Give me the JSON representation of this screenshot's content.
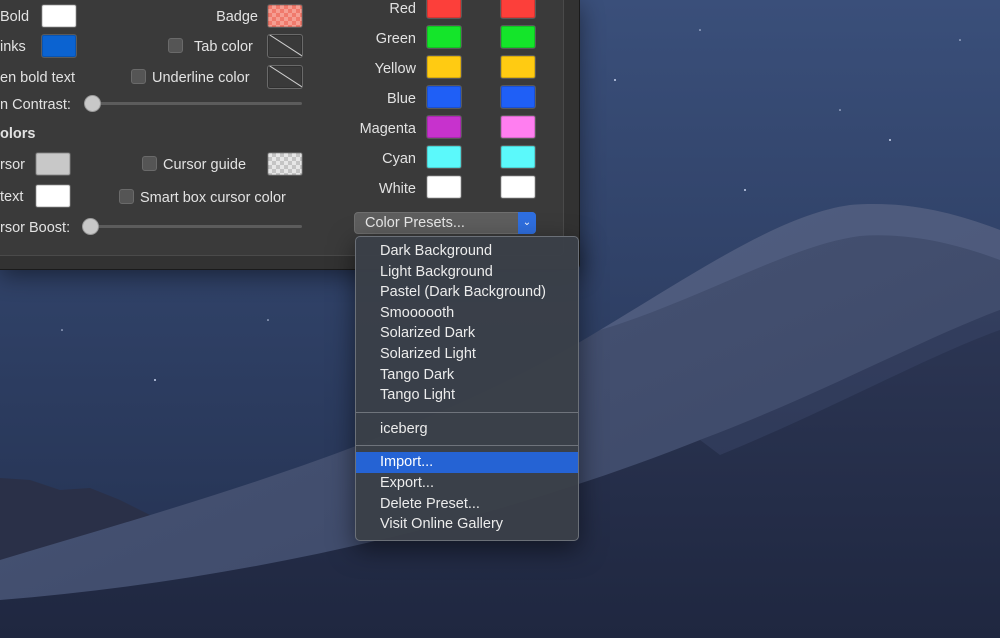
{
  "panel": {
    "left_labels": [
      {
        "id": "bold",
        "text": "Bold"
      },
      {
        "id": "links",
        "text": "inks"
      },
      {
        "id": "bright_bold",
        "text": "en bold text"
      },
      {
        "id": "min_contrast",
        "text": "n Contrast:"
      },
      {
        "id": "cursor_colors_heading",
        "text": "olors"
      },
      {
        "id": "cursor",
        "text": "rsor"
      },
      {
        "id": "cursor_text",
        "text": "text"
      },
      {
        "id": "cursor_boost",
        "text": "rsor Boost:"
      }
    ],
    "middle_labels": {
      "badge": "Badge",
      "tab_color": "Tab color",
      "underline_color": "Underline color",
      "cursor_guide": "Cursor guide",
      "smart_box": "Smart box cursor color"
    },
    "colors": {
      "bold": "#ffffff",
      "links": "#0b63d1",
      "badge": "#f07a6c",
      "cursor": "#c8c8c8",
      "cursor_text": "#ffffff"
    },
    "ansi": [
      {
        "name": "Red",
        "normal": "#fc3f3a",
        "bright": "#fc3f3a"
      },
      {
        "name": "Green",
        "normal": "#14e52a",
        "bright": "#14e52a"
      },
      {
        "name": "Yellow",
        "normal": "#ffcb12",
        "bright": "#ffcb12"
      },
      {
        "name": "Blue",
        "normal": "#1f5ff6",
        "bright": "#1f5ff6"
      },
      {
        "name": "Magenta",
        "normal": "#c732cd",
        "bright": "#ff7ef0"
      },
      {
        "name": "Cyan",
        "normal": "#5bf9fb",
        "bright": "#5bf9fb"
      },
      {
        "name": "White",
        "normal": "#ffffff",
        "bright": "#ffffff"
      }
    ],
    "sliders": {
      "min_contrast": 0.0,
      "cursor_boost": 0.0
    },
    "color_presets_button": "Color Presets...",
    "dropdown_arrow_icon": "chevron-down-icon"
  },
  "menu": {
    "groups": [
      [
        "Dark Background",
        "Light Background",
        "Pastel (Dark Background)",
        "Smoooooth",
        "Solarized Dark",
        "Solarized Light",
        "Tango Dark",
        "Tango Light"
      ],
      [
        "iceberg"
      ],
      [
        "Import...",
        "Export...",
        "Delete Preset...",
        "Visit Online Gallery"
      ]
    ],
    "selected": "Import...",
    "highlight_color": "#2563d4"
  }
}
